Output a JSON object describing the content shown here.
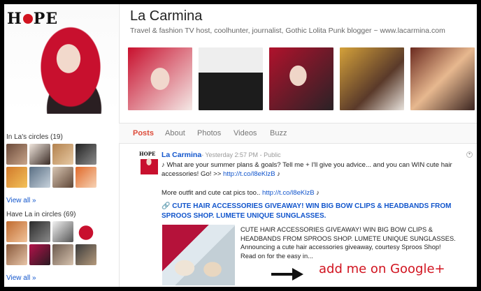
{
  "profile": {
    "logo_text": "HOPE",
    "name": "La Carmina",
    "tagline": "Travel & fashion TV host, coolhunter, journalist, Gothic Lolita Punk blogger ~ www.lacarmina.com"
  },
  "sidebar": {
    "in_circles_label": "In La's circles (19)",
    "have_in_circles_label": "Have La in circles (69)",
    "view_all": "View all »"
  },
  "tabs": [
    {
      "label": "Posts",
      "active": true
    },
    {
      "label": "About",
      "active": false
    },
    {
      "label": "Photos",
      "active": false
    },
    {
      "label": "Videos",
      "active": false
    },
    {
      "label": "Buzz",
      "active": false
    }
  ],
  "post": {
    "author": "La Carmina",
    "timestamp": "Yesterday 2:57 PM",
    "visibility": "Public",
    "meta_separator": "-",
    "line1": "♪ What are your summer plans & goals? Tell me + I'll give you advice... and you can WIN cute hair accessories! Go! >> ",
    "line1_link": "http://t.co/l8eKlzB",
    "line1_suffix": " ♪",
    "line2": "More outfit and cute cat pics too.. ",
    "line2_link": "http://t.co/l8eKlzB",
    "line2_suffix": " ♪",
    "share_title": "CUTE HAIR ACCESSORIES GIVEAWAY! WIN BIG BOW CLIPS & HEADBANDS FROM SPROOS SHOP. LUMETE UNIQUE SUNGLASSES.",
    "share_description": "CUTE HAIR ACCESSORIES GIVEAWAY! WIN BIG BOW CLIPS & HEADBANDS FROM SPROOS SHOP. LUMETE UNIQUE SUNGLASSES. Announcing a cute hair accessories giveaway, courtesy Sproos Shop! Read on for the easy in..."
  },
  "promo": {
    "text": "add me on Google+"
  },
  "colors": {
    "link": "#1155cc",
    "active_tab": "#dd4b39",
    "promo_red": "#d1131f"
  }
}
